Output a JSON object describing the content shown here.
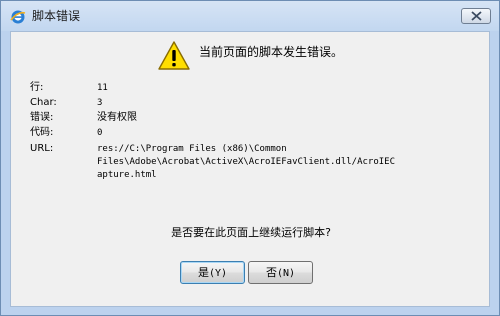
{
  "window": {
    "title": "脚本错误",
    "close_icon": "close-icon",
    "app_icon": "ie-icon"
  },
  "dialog": {
    "headline": "当前页面的脚本发生错误。",
    "warning_icon": "warning-icon",
    "fields": {
      "line_label": "行:",
      "line_value": "11",
      "char_label": "Char:",
      "char_value": "3",
      "error_label": "错误:",
      "error_value": "没有权限",
      "code_label": "代码:",
      "code_value": "0",
      "url_label": "URL:",
      "url_lines": [
        "res://C:\\Program Files (x86)\\Common",
        "Files\\Adobe\\Acrobat\\ActiveX\\AcroIEFavClient.dll/AcroIEC",
        "apture.html"
      ]
    },
    "question": "是否要在此页面上继续运行脚本?",
    "buttons": {
      "yes_label": "是",
      "yes_shortcut": "(Y)",
      "no_label": "否",
      "no_shortcut": "(N)"
    }
  },
  "colors": {
    "frame": "#bcd2ee",
    "client": "#f0f0f0",
    "warning_fill": "#ffde00"
  }
}
